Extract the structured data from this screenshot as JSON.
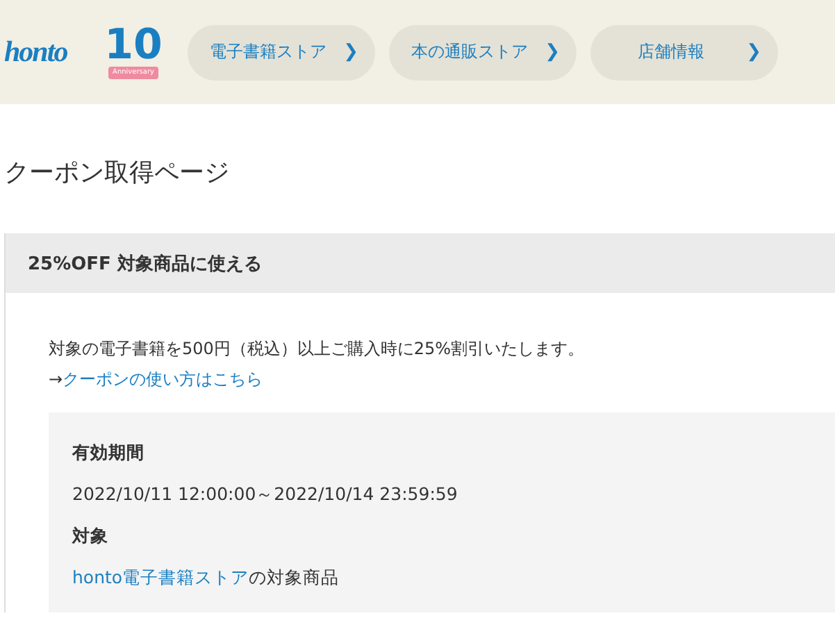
{
  "header": {
    "logo": "honto",
    "anniversary": {
      "number": "10",
      "label": "Anniversary"
    },
    "nav": [
      {
        "label": "電子書籍ストア",
        "arrow": "❯"
      },
      {
        "label": "本の通販ストア",
        "arrow": "❯"
      },
      {
        "label": "店舗情報",
        "arrow": "❯"
      }
    ]
  },
  "page_title": "クーポン取得ページ",
  "coupon": {
    "title": "25%OFF 対象商品に使える",
    "description": "対象の電子書籍を500円（税込）以上ご購入時に25%割引いたします。",
    "help_arrow": "→",
    "help_link": "クーポンの使い方はこちら",
    "details": [
      {
        "label": "有効期間",
        "value": "2022/10/11 12:00:00～2022/10/14 23:59:59"
      },
      {
        "label": "対象",
        "link": "honto電子書籍ストア",
        "value": "の対象商品"
      }
    ]
  }
}
